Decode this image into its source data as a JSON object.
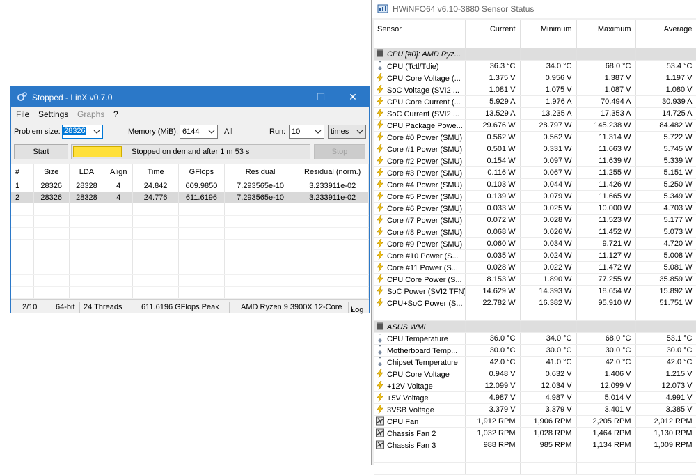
{
  "linx": {
    "title": "Stopped - LinX v0.7.0",
    "controls": {
      "minimize": "—",
      "maximize": "☐",
      "close": "✕"
    },
    "menu": [
      "File",
      "Settings",
      "Graphs",
      "?"
    ],
    "problem_size_label": "Problem size:",
    "problem_size_value": "28326",
    "memory_label": "Memory (MiB):",
    "memory_value": "6144",
    "all_label": "All",
    "run_label": "Run:",
    "run_value": "10",
    "run_unit": "times",
    "start_button": "Start",
    "stop_button": "Stop",
    "progress_text": "Stopped on demand after 1 m 53 s",
    "progress_fraction": 0.2,
    "columns": [
      "#",
      "Size",
      "LDA",
      "Align",
      "Time",
      "GFlops",
      "Residual",
      "Residual (norm.)"
    ],
    "rows": [
      [
        "1",
        "28326",
        "28328",
        "4",
        "24.842",
        "609.9850",
        "7.293565e-10",
        "3.233911e-02"
      ],
      [
        "2",
        "28326",
        "28328",
        "4",
        "24.776",
        "611.6196",
        "7.293565e-10",
        "3.233911e-02"
      ]
    ],
    "selected_row": 1,
    "status": {
      "progress": "2/10",
      "bits": "64-bit",
      "threads": "24 Threads",
      "peak": "611.6196 GFlops Peak",
      "cpu": "AMD Ryzen 9 3900X 12-Core",
      "log": "Log",
      "log_arrow": "›"
    }
  },
  "hwinfo": {
    "title": "HWiNFO64 v6.10-3880 Sensor Status",
    "columns": [
      "Sensor",
      "Current",
      "Minimum",
      "Maximum",
      "Average"
    ],
    "rows": [
      {
        "type": "group",
        "name": "CPU [#0]: AMD Ryz..."
      },
      {
        "icon": "thermometer",
        "name": "CPU (Tctl/Tdie)",
        "cur": "36.3 °C",
        "min": "34.0 °C",
        "max": "68.0 °C",
        "avg": "53.4 °C"
      },
      {
        "icon": "bolt",
        "name": "CPU Core Voltage (...",
        "cur": "1.375 V",
        "min": "0.956 V",
        "max": "1.387 V",
        "avg": "1.197 V"
      },
      {
        "icon": "bolt",
        "name": "SoC Voltage (SVI2 ...",
        "cur": "1.081 V",
        "min": "1.075 V",
        "max": "1.087 V",
        "avg": "1.080 V"
      },
      {
        "icon": "bolt",
        "name": "CPU Core Current (...",
        "cur": "5.929 A",
        "min": "1.976 A",
        "max": "70.494 A",
        "avg": "30.939 A"
      },
      {
        "icon": "bolt",
        "name": "SoC Current (SVI2 ...",
        "cur": "13.529 A",
        "min": "13.235 A",
        "max": "17.353 A",
        "avg": "14.725 A"
      },
      {
        "icon": "bolt",
        "name": "CPU Package Powe...",
        "cur": "29.676 W",
        "min": "28.797 W",
        "max": "145.238 W",
        "avg": "84.482 W"
      },
      {
        "icon": "bolt",
        "name": "Core #0 Power (SMU)",
        "cur": "0.562 W",
        "min": "0.562 W",
        "max": "11.314 W",
        "avg": "5.722 W"
      },
      {
        "icon": "bolt",
        "name": "Core #1 Power (SMU)",
        "cur": "0.501 W",
        "min": "0.331 W",
        "max": "11.663 W",
        "avg": "5.745 W"
      },
      {
        "icon": "bolt",
        "name": "Core #2 Power (SMU)",
        "cur": "0.154 W",
        "min": "0.097 W",
        "max": "11.639 W",
        "avg": "5.339 W"
      },
      {
        "icon": "bolt",
        "name": "Core #3 Power (SMU)",
        "cur": "0.116 W",
        "min": "0.067 W",
        "max": "11.255 W",
        "avg": "5.151 W"
      },
      {
        "icon": "bolt",
        "name": "Core #4 Power (SMU)",
        "cur": "0.103 W",
        "min": "0.044 W",
        "max": "11.426 W",
        "avg": "5.250 W"
      },
      {
        "icon": "bolt",
        "name": "Core #5 Power (SMU)",
        "cur": "0.139 W",
        "min": "0.079 W",
        "max": "11.665 W",
        "avg": "5.349 W"
      },
      {
        "icon": "bolt",
        "name": "Core #6 Power (SMU)",
        "cur": "0.033 W",
        "min": "0.025 W",
        "max": "10.000 W",
        "avg": "4.703 W"
      },
      {
        "icon": "bolt",
        "name": "Core #7 Power (SMU)",
        "cur": "0.072 W",
        "min": "0.028 W",
        "max": "11.523 W",
        "avg": "5.177 W"
      },
      {
        "icon": "bolt",
        "name": "Core #8 Power (SMU)",
        "cur": "0.068 W",
        "min": "0.026 W",
        "max": "11.452 W",
        "avg": "5.073 W"
      },
      {
        "icon": "bolt",
        "name": "Core #9 Power (SMU)",
        "cur": "0.060 W",
        "min": "0.034 W",
        "max": "9.721 W",
        "avg": "4.720 W"
      },
      {
        "icon": "bolt",
        "name": "Core #10 Power (S...",
        "cur": "0.035 W",
        "min": "0.024 W",
        "max": "11.127 W",
        "avg": "5.008 W"
      },
      {
        "icon": "bolt",
        "name": "Core #11 Power (S...",
        "cur": "0.028 W",
        "min": "0.022 W",
        "max": "11.472 W",
        "avg": "5.081 W"
      },
      {
        "icon": "bolt",
        "name": "CPU Core Power (S...",
        "cur": "8.153 W",
        "min": "1.890 W",
        "max": "77.255 W",
        "avg": "35.859 W"
      },
      {
        "icon": "bolt",
        "name": "SoC Power (SVI2 TFN)",
        "cur": "14.629 W",
        "min": "14.393 W",
        "max": "18.654 W",
        "avg": "15.892 W"
      },
      {
        "icon": "bolt",
        "name": "CPU+SoC Power (S...",
        "cur": "22.782 W",
        "min": "16.382 W",
        "max": "95.910 W",
        "avg": "51.751 W"
      },
      {
        "type": "gap"
      },
      {
        "type": "group",
        "name": "ASUS WMI"
      },
      {
        "icon": "thermometer",
        "name": "CPU Temperature",
        "cur": "36.0 °C",
        "min": "34.0 °C",
        "max": "68.0 °C",
        "avg": "53.1 °C"
      },
      {
        "icon": "thermometer",
        "name": "Motherboard Temp...",
        "cur": "30.0 °C",
        "min": "30.0 °C",
        "max": "30.0 °C",
        "avg": "30.0 °C"
      },
      {
        "icon": "thermometer",
        "name": "Chipset Temperature",
        "cur": "42.0 °C",
        "min": "41.0 °C",
        "max": "42.0 °C",
        "avg": "42.0 °C"
      },
      {
        "icon": "bolt",
        "name": "CPU Core Voltage",
        "cur": "0.948 V",
        "min": "0.632 V",
        "max": "1.406 V",
        "avg": "1.215 V"
      },
      {
        "icon": "bolt",
        "name": "+12V Voltage",
        "cur": "12.099 V",
        "min": "12.034 V",
        "max": "12.099 V",
        "avg": "12.073 V"
      },
      {
        "icon": "bolt",
        "name": "+5V Voltage",
        "cur": "4.987 V",
        "min": "4.987 V",
        "max": "5.014 V",
        "avg": "4.991 V"
      },
      {
        "icon": "bolt",
        "name": "3VSB Voltage",
        "cur": "3.379 V",
        "min": "3.379 V",
        "max": "3.401 V",
        "avg": "3.385 V"
      },
      {
        "icon": "fan",
        "name": "CPU Fan",
        "cur": "1,912 RPM",
        "min": "1,906 RPM",
        "max": "2,205 RPM",
        "avg": "2,012 RPM"
      },
      {
        "icon": "fan",
        "name": "Chassis Fan 2",
        "cur": "1,032 RPM",
        "min": "1,028 RPM",
        "max": "1,464 RPM",
        "avg": "1,130 RPM"
      },
      {
        "icon": "fan",
        "name": "Chassis Fan 3",
        "cur": "988 RPM",
        "min": "985 RPM",
        "max": "1,134 RPM",
        "avg": "1,009 RPM"
      },
      {
        "type": "gap"
      },
      {
        "type": "gap"
      }
    ]
  },
  "colors": {
    "linx_titlebar": "#2b78c8",
    "progress_fill": "#ffe03a",
    "selection": "#d9d9d9",
    "group_row": "#dedede"
  }
}
